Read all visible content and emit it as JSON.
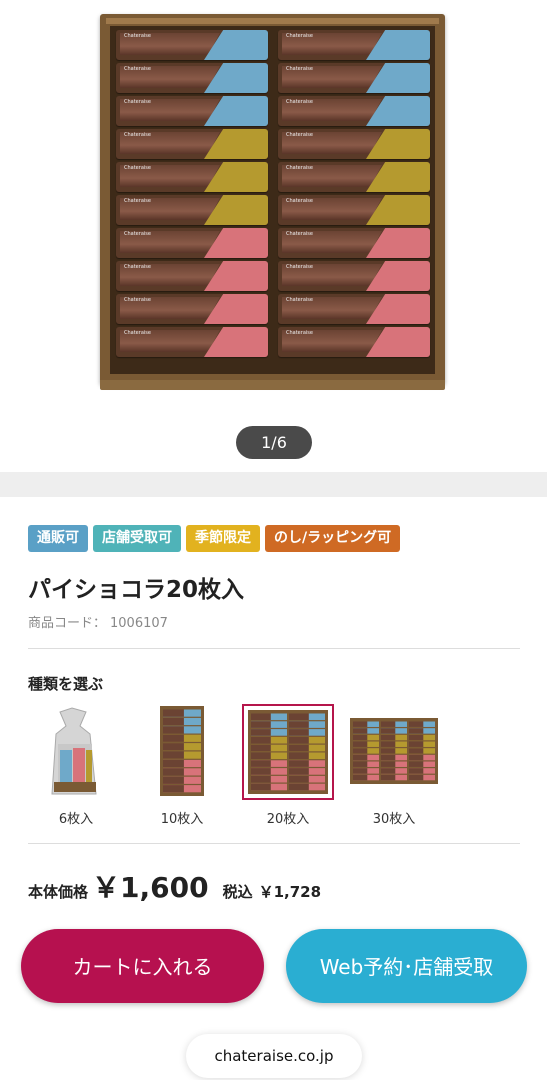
{
  "gallery": {
    "pager": "1/6"
  },
  "badges": [
    {
      "label": "通販可",
      "color": "#5aa0c6"
    },
    {
      "label": "店舗受取可",
      "color": "#4fb3b8"
    },
    {
      "label": "季節限定",
      "color": "#e2b21f"
    },
    {
      "label": "のし/ラッピング可",
      "color": "#cf6a24"
    }
  ],
  "product": {
    "title": "パイショコラ20枚入",
    "code_label": "商品コード：",
    "code": "1006107"
  },
  "variants": {
    "heading": "種類を選ぶ",
    "items": [
      {
        "label": "6枚入",
        "selected": false
      },
      {
        "label": "10枚入",
        "selected": false
      },
      {
        "label": "20枚入",
        "selected": true
      },
      {
        "label": "30枚入",
        "selected": false
      }
    ]
  },
  "price": {
    "label": "本体価格",
    "amount": "￥1,600",
    "tax_label": "税込",
    "tax_amount": "￥1,728"
  },
  "actions": {
    "cart": "カートに入れる",
    "web": "Web予約･店舗受取"
  },
  "browser": {
    "url": "chateraise.co.jp"
  },
  "colors": {
    "cart": "#b6114f",
    "web": "#2aaed2",
    "selected_border": "#b5154b"
  }
}
